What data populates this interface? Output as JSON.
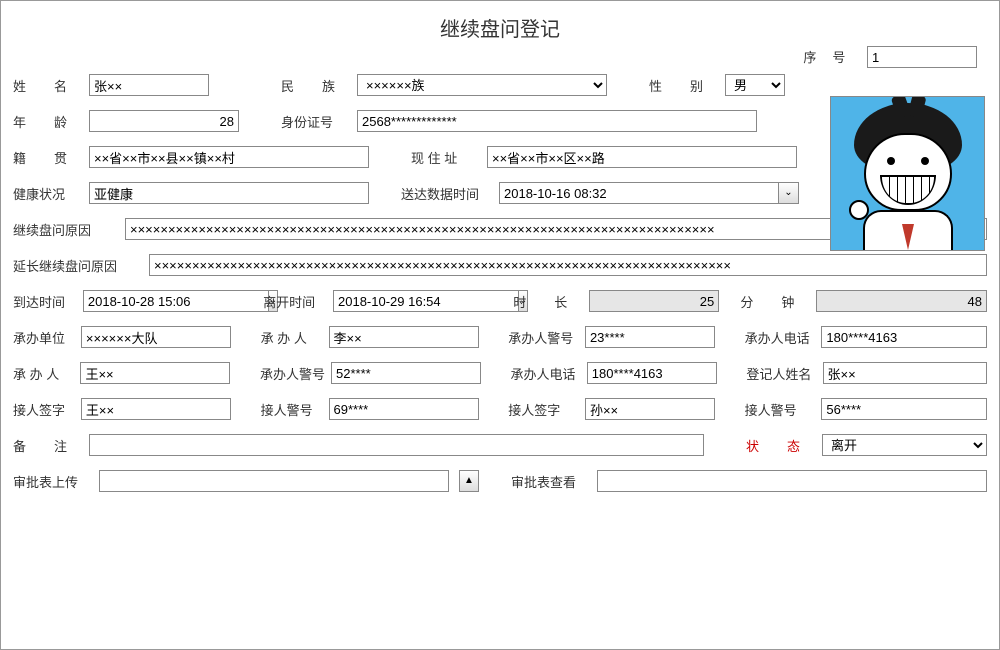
{
  "title": "继续盘问登记",
  "serial": {
    "label": "序号",
    "value": "1"
  },
  "labels": {
    "name": "姓名",
    "ethnic": "民族",
    "gender": "性别",
    "age": "年龄",
    "id": "身份证号",
    "origin": "籍贯",
    "address": "现 住 址",
    "health": "健康状况",
    "delivery": "送达数据时间",
    "reason": "继续盘问原因",
    "extend_reason": "延长继续盘问原因",
    "arrive": "到达时间",
    "leave": "离开时间",
    "duration": "时长",
    "minute": "分钟",
    "unit": "承办单位",
    "handler": "承 办 人",
    "handler_badge": "承办人警号",
    "handler_phone": "承办人电话",
    "registrar": "登记人姓名",
    "recv_sign": "接人签字",
    "recv_badge": "接人警号",
    "remark": "备注",
    "status": "状态",
    "upload": "审批表上传",
    "view": "审批表查看"
  },
  "values": {
    "name": "张××",
    "ethnic": "××××××族",
    "gender": "男",
    "age": "28",
    "id": "2568*************",
    "origin": "××省××市××县××镇××村",
    "address": "××省××市××区××路",
    "health": "亚健康",
    "delivery": "2018-10-16 08:32",
    "reason": "×××××××××××××××××××××××××××××××××××××××××××××××××××××××××××××××××××××××××××××",
    "extend_reason": "××××××××××××××××××××××××××××××××××××××××××××××××××××××××××××××××××××××××××××",
    "arrive": "2018-10-28 15:06",
    "leave": "2018-10-29 16:54",
    "duration": "25",
    "minute": "48",
    "unit": "××××××大队",
    "handler1": "李××",
    "handler1_badge": "23****",
    "handler1_phone": "180****4163",
    "handler2": "王××",
    "handler2_badge": "52****",
    "handler2_phone": "180****4163",
    "registrar": "张××",
    "recv_sign1": "王××",
    "recv_badge1": "69****",
    "recv_sign2": "孙××",
    "recv_badge2": "56****",
    "remark": "",
    "status": "离开",
    "upload_path": "",
    "view_path": ""
  },
  "icons": {
    "dropdown": "⌄",
    "up": "▲"
  }
}
